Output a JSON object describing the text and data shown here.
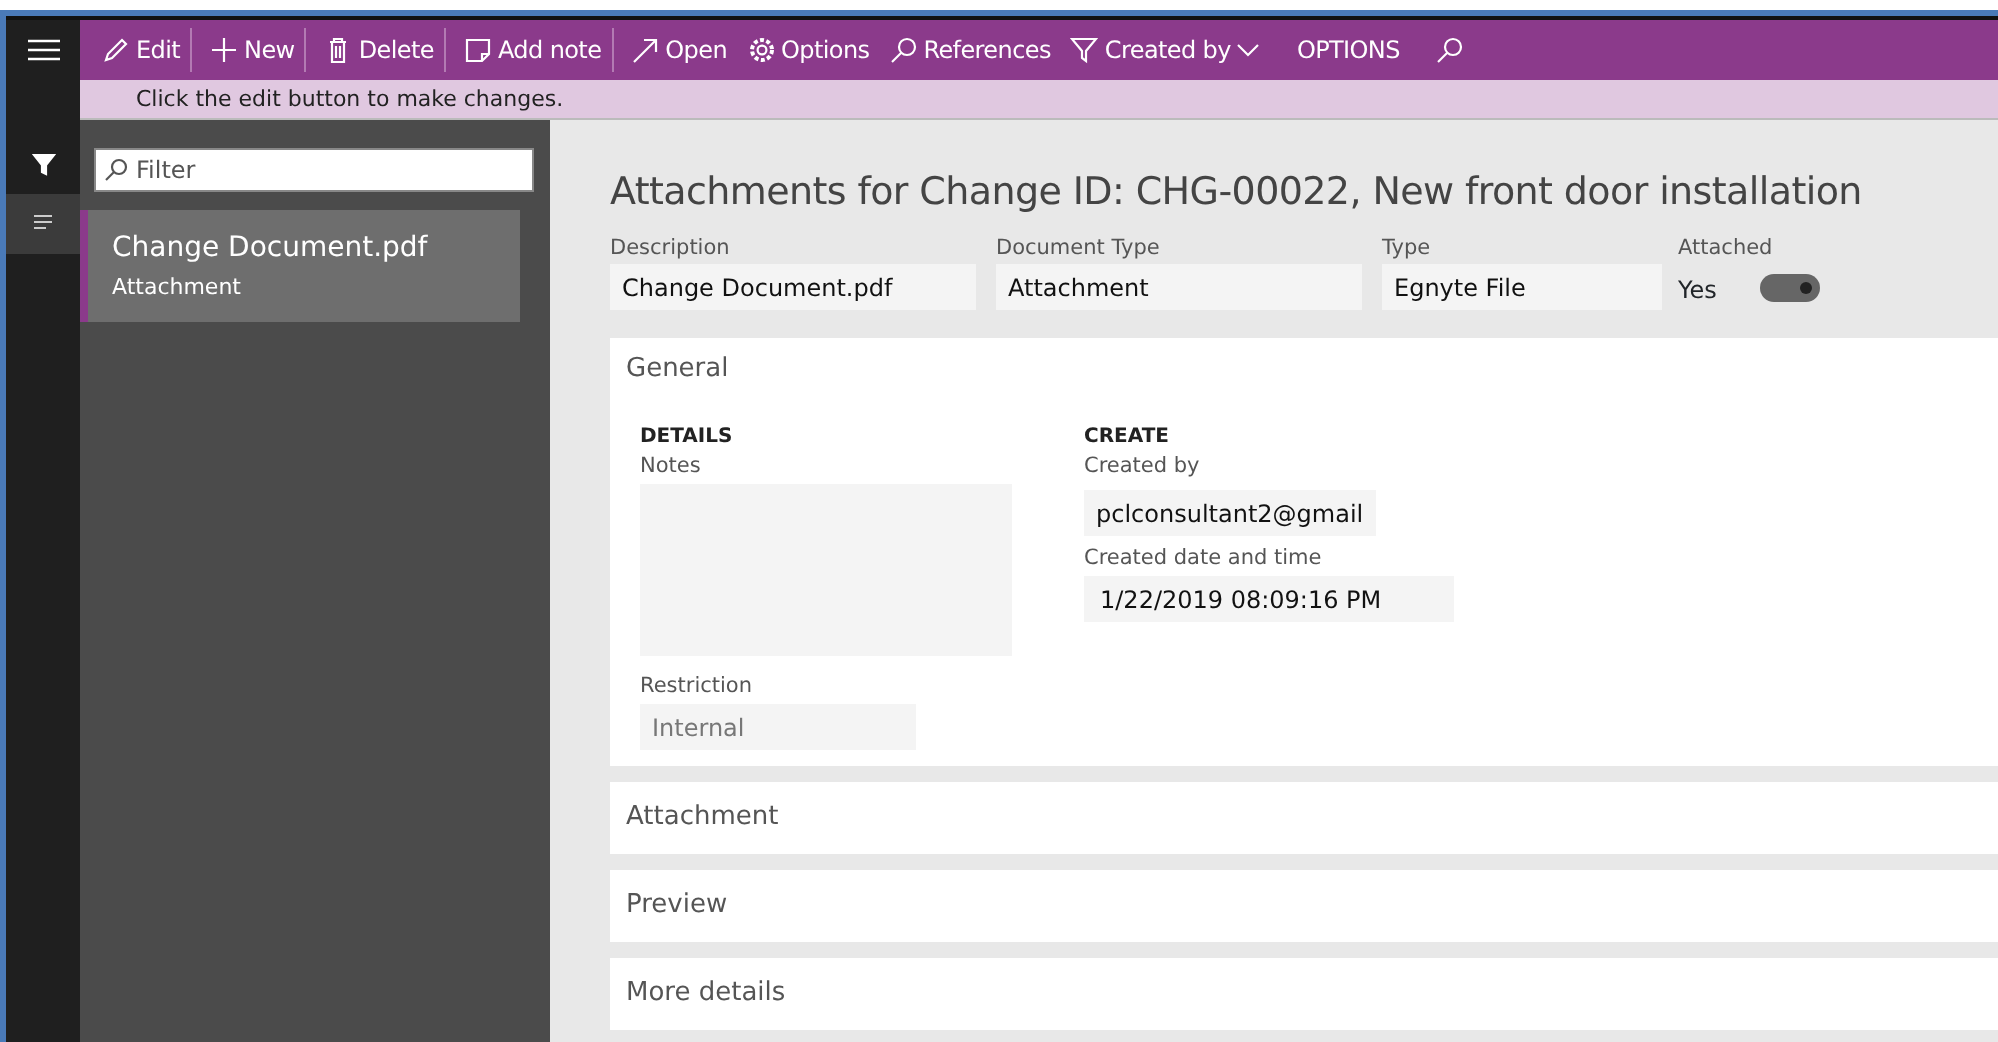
{
  "toolbar": {
    "items": [
      {
        "label": "Edit",
        "divider_after": true
      },
      {
        "label": "New",
        "divider_after": true
      },
      {
        "label": "Delete",
        "divider_after": true
      },
      {
        "label": "Add note",
        "divider_after": true
      },
      {
        "label": "Open",
        "divider_after": false
      },
      {
        "label": "Options",
        "divider_after": false
      },
      {
        "label": "References",
        "divider_after": false
      },
      {
        "label": "Created by",
        "divider_after": false
      },
      {
        "label": "OPTIONS",
        "divider_after": false
      }
    ]
  },
  "message_bar": {
    "text": "Click the edit button to make changes."
  },
  "nav_panes": [
    {
      "selected": false
    },
    {
      "selected": true
    }
  ],
  "list": {
    "filter": {
      "placeholder": "Filter"
    },
    "items": [
      {
        "title": "Change Document.pdf",
        "subtitle": "Attachment",
        "selected": true
      }
    ]
  },
  "form": {
    "title": "Attachments for Change ID: CHG-00022, New front door installation",
    "header_fields": [
      {
        "label": "Description",
        "value": "Change Document.pdf"
      },
      {
        "label": "Document Type",
        "value": "Attachment"
      },
      {
        "label": "Type",
        "value": "Egnyte File"
      }
    ],
    "attached": {
      "label": "Attached",
      "value": "Yes",
      "on": true
    },
    "sections": [
      {
        "title": "General",
        "expanded": true
      },
      {
        "title": "Attachment",
        "expanded": false
      },
      {
        "title": "Preview",
        "expanded": false
      },
      {
        "title": "More details",
        "expanded": false
      }
    ],
    "general": {
      "details": {
        "heading": "DETAILS",
        "notes_label": "Notes",
        "restriction_label": "Restriction",
        "restriction_value": "Internal"
      },
      "create": {
        "heading": "CREATE",
        "created_by_label": "Created by",
        "created_by_value": "pclconsultant2@gmail",
        "created_at_label": "Created date and time",
        "created_at_value": "1/22/2019 08:09:16 PM"
      }
    }
  }
}
